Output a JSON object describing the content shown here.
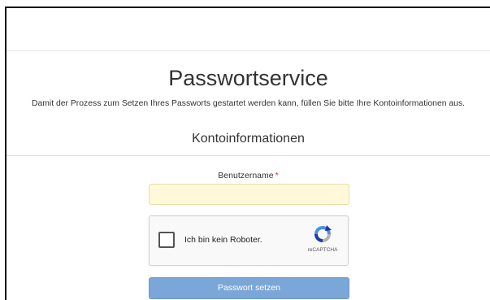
{
  "page": {
    "title": "Passwortservice",
    "description": "Damit der Prozess zum Setzen Ihres Passworts gestartet werden kann, füllen Sie bitte Ihre Kontoinformationen aus."
  },
  "section": {
    "title": "Kontoinformationen"
  },
  "form": {
    "username_label": "Benutzername",
    "required_marker": "*",
    "username_value": "",
    "submit_label": "Passwort setzen"
  },
  "captcha": {
    "label": "Ich bin kein Roboter.",
    "brand": "reCAPTCHA",
    "checked": false,
    "icon": "recaptcha-logo-icon"
  },
  "colors": {
    "input_bg": "#fff9d9",
    "required": "#e0242c",
    "button_bg": "#7ba7d8",
    "captcha_blue": "#1c3aa9",
    "captcha_light": "#4a90e2"
  }
}
